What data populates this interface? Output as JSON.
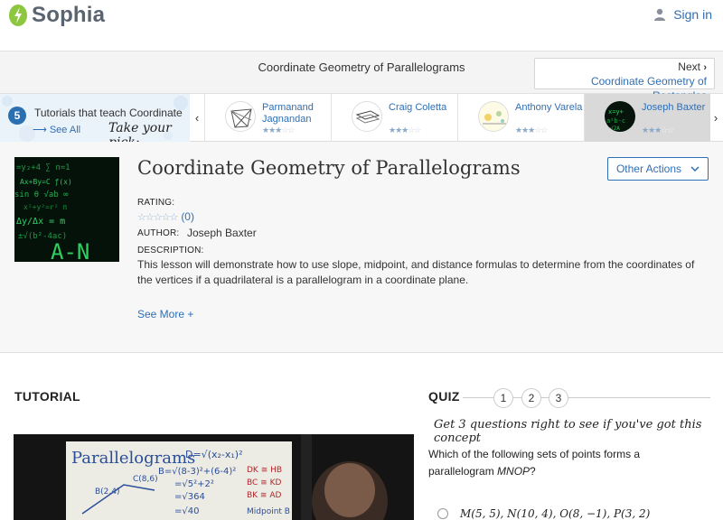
{
  "header": {
    "logo_text": "Sophia",
    "signin_label": "Sign in"
  },
  "nav": {
    "title": "Coordinate Geometry of Parallelograms",
    "next_label": "Next",
    "next_link": "Coordinate Geometry of Rectangles"
  },
  "strip": {
    "count": "5",
    "intro_text": "Tutorials that teach Coordinate",
    "see_all": "See All",
    "take_pick": "Take your pick:",
    "cards": [
      {
        "name": "Parmanand Jagnandan",
        "rating": 3
      },
      {
        "name": "Craig Coletta",
        "rating": 3
      },
      {
        "name": "Anthony Varela",
        "rating": 3
      },
      {
        "name": "Joseph Baxter",
        "rating": 3
      }
    ]
  },
  "lesson": {
    "title": "Coordinate Geometry of Parallelograms",
    "other_actions": "Other Actions",
    "rating_label": "RATING:",
    "rating_count": "(0)",
    "author_label": "AUTHOR:",
    "author_name": "Joseph Baxter",
    "description_label": "DESCRIPTION:",
    "description": "This lesson will demonstrate how to use slope, midpoint, and distance formulas to determine from the coordinates of the vertices if a quadrilateral is a parallelogram in a coordinate plane.",
    "see_more": "See More +"
  },
  "tutorial": {
    "title": "TUTORIAL",
    "video_heading": "Parallelograms"
  },
  "quiz": {
    "title": "QUIZ",
    "steps": [
      "1",
      "2",
      "3"
    ],
    "hint": "Get 3 questions right to see if you've got this concept",
    "question_prefix": "Which of the following sets of points forms a parallelogram ",
    "question_var": "MNOP",
    "question_suffix": "?",
    "option_1": "M(5, 5), N(10, 4), O(8, −1), P(3, 2)"
  },
  "colors": {
    "accent": "#2f6fb5",
    "logo_green": "#8dc63f"
  }
}
